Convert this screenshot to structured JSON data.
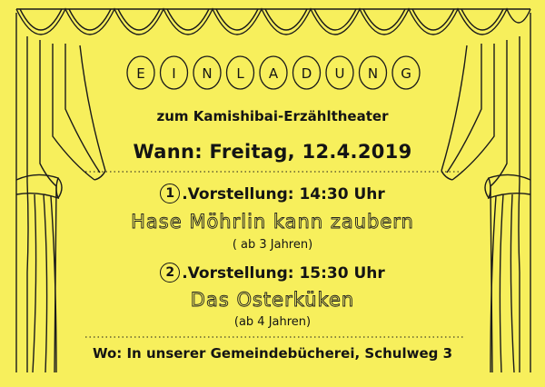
{
  "invitation": {
    "title_letters": [
      "E",
      "I",
      "N",
      "L",
      "A",
      "D",
      "U",
      "N",
      "G"
    ],
    "subtitle": "zum Kamishibai-Erzähltheater",
    "when": "Wann: Freitag, 12.4.2019",
    "shows": [
      {
        "number": "1",
        "label": ".Vorstellung: 14:30 Uhr",
        "title": "Hase Möhrlin kann zaubern",
        "age": "( ab 3 Jahren)"
      },
      {
        "number": "2",
        "label": ".Vorstellung: 15:30 Uhr",
        "title": "Das Osterküken",
        "age": "(ab 4 Jahren)"
      }
    ],
    "where": "Wo: In unserer Gemeindebücherei, Schulweg 3"
  },
  "colors": {
    "paper": "#f7ef5c",
    "ink": "#141414"
  }
}
